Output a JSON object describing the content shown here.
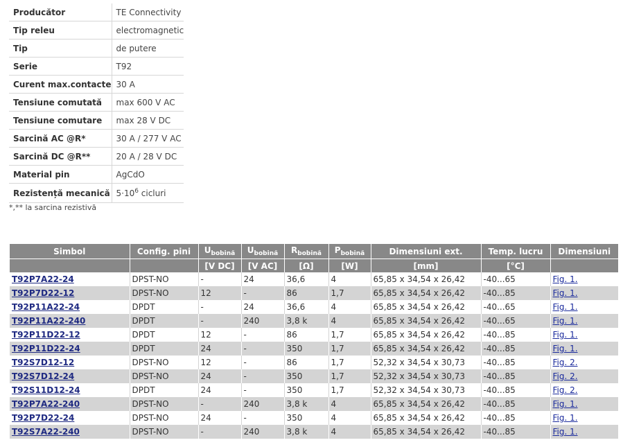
{
  "specs": [
    {
      "label": "Producător",
      "value": "TE Connectivity"
    },
    {
      "label": "Tip releu",
      "value": "electromagnetic"
    },
    {
      "label": "Tip",
      "value": "de putere"
    },
    {
      "label": "Serie",
      "value": "T92"
    },
    {
      "label": "Curent max.contacte",
      "value": "30 A"
    },
    {
      "label": "Tensiune comutată",
      "value": "max 600 V AC"
    },
    {
      "label": "Tensiune comutare",
      "value": "max 28 V DC"
    },
    {
      "label": "Sarcină AC @R*",
      "value": "30 A / 277 V AC"
    },
    {
      "label": "Sarcină DC @R**",
      "value": "20 A / 28 V DC"
    },
    {
      "label": "Material pin",
      "value": "AgCdO"
    },
    {
      "label": "Rezistență mecanică",
      "value_base": "5·10",
      "value_exp": "6",
      "value_rest": " cicluri"
    }
  ],
  "footnote": "*,** la sarcina rezistivă",
  "table": {
    "headers": [
      {
        "main": "Simbol",
        "sub": "",
        "unit": ""
      },
      {
        "main": "Config. pini",
        "sub": "",
        "unit": ""
      },
      {
        "main": "U",
        "sub": "bobină",
        "unit": "[V DC]"
      },
      {
        "main": "U",
        "sub": "bobină",
        "unit": "[V AC]"
      },
      {
        "main": "R",
        "sub": "bobină",
        "unit": "[Ω]"
      },
      {
        "main": "P",
        "sub": "bobină",
        "unit": "[W]"
      },
      {
        "main": "Dimensiuni ext.",
        "sub": "",
        "unit": "[mm]"
      },
      {
        "main": "Temp. lucru",
        "sub": "",
        "unit": "[°C]"
      },
      {
        "main": "Dimensiuni",
        "sub": "",
        "unit": ""
      }
    ],
    "rows": [
      {
        "symbol": "T92P7A22-24",
        "config": "DPST-NO",
        "udc": "-",
        "uac": "24",
        "r": "36,6",
        "p": "4",
        "dim": "65,85 x 34,54 x 26,42",
        "temp": "-40...65",
        "fig": "Fig. 1."
      },
      {
        "symbol": "T92P7D22-12",
        "config": "DPST-NO",
        "udc": "12",
        "uac": "-",
        "r": "86",
        "p": "1,7",
        "dim": "65,85 x 34,54 x 26,42",
        "temp": "-40...85",
        "fig": "Fig. 1."
      },
      {
        "symbol": "T92P11A22-24",
        "config": "DPDT",
        "udc": "-",
        "uac": "24",
        "r": "36,6",
        "p": "4",
        "dim": "65,85 x 34,54 x 26,42",
        "temp": "-40...65",
        "fig": "Fig. 1."
      },
      {
        "symbol": "T92P11A22-240",
        "config": "DPDT",
        "udc": "-",
        "uac": "240",
        "r": "3,8 k",
        "p": "4",
        "dim": "65,85 x 34,54 x 26,42",
        "temp": "-40...65",
        "fig": "Fig. 1."
      },
      {
        "symbol": "T92P11D22-12",
        "config": "DPDT",
        "udc": "12",
        "uac": "-",
        "r": "86",
        "p": "1,7",
        "dim": "65,85 x 34,54 x 26,42",
        "temp": "-40...85",
        "fig": "Fig. 1."
      },
      {
        "symbol": "T92P11D22-24",
        "config": "DPDT",
        "udc": "24",
        "uac": "-",
        "r": "350",
        "p": "1,7",
        "dim": "65,85 x 34,54 x 26,42",
        "temp": "-40...85",
        "fig": "Fig. 1."
      },
      {
        "symbol": "T92S7D12-12",
        "config": "DPST-NO",
        "udc": "12",
        "uac": "-",
        "r": "86",
        "p": "1,7",
        "dim": "52,32 x 34,54 x 30,73",
        "temp": "-40...85",
        "fig": "Fig. 2."
      },
      {
        "symbol": "T92S7D12-24",
        "config": "DPST-NO",
        "udc": "24",
        "uac": "-",
        "r": "350",
        "p": "1,7",
        "dim": "52,32 x 34,54 x 30,73",
        "temp": "-40...85",
        "fig": "Fig. 2."
      },
      {
        "symbol": "T92S11D12-24",
        "config": "DPDT",
        "udc": "24",
        "uac": "-",
        "r": "350",
        "p": "1,7",
        "dim": "52,32 x 34,54 x 30,73",
        "temp": "-40...85",
        "fig": "Fig. 2."
      },
      {
        "symbol": "T92P7A22-240",
        "config": "DPST-NO",
        "udc": "-",
        "uac": "240",
        "r": "3,8 k",
        "p": "4",
        "dim": "65,85 x 34,54 x 26,42",
        "temp": "-40...85",
        "fig": "Fig. 1."
      },
      {
        "symbol": "T92P7D22-24",
        "config": "DPST-NO",
        "udc": "24",
        "uac": "-",
        "r": "350",
        "p": "4",
        "dim": "65,85 x 34,54 x 26,42",
        "temp": "-40...85",
        "fig": "Fig. 1."
      },
      {
        "symbol": "T92S7A22-240",
        "config": "DPST-NO",
        "udc": "-",
        "uac": "240",
        "r": "3,8 k",
        "p": "4",
        "dim": "65,85 x 34,54 x 26,42",
        "temp": "-40...85",
        "fig": "Fig. 1."
      }
    ]
  },
  "colors": {
    "header_bg": "#888888",
    "stripe": "#d4d4d4",
    "link": "#1f2a82"
  }
}
